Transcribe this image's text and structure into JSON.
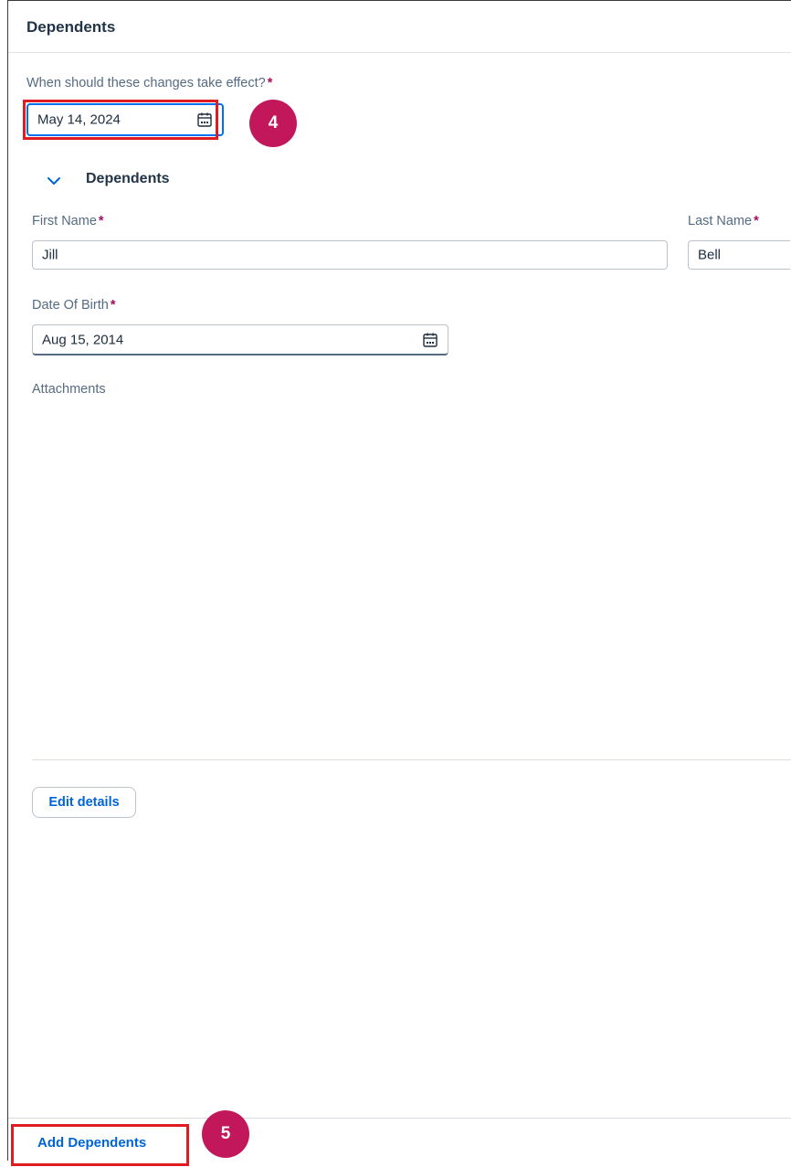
{
  "header": {
    "title": "Dependents"
  },
  "effective_date": {
    "label": "When should these changes take effect?",
    "required_mark": "*",
    "value": "May 14, 2024",
    "icon": "calendar-icon"
  },
  "callouts": {
    "step4": "4",
    "step5": "5"
  },
  "section": {
    "title": "Dependents",
    "toggle_icon": "chevron-down-icon"
  },
  "dependent": {
    "first_name_label": "First Name",
    "first_name_value": "Jill",
    "last_name_label": "Last Name",
    "last_name_value": "Bell",
    "dob_label": "Date Of Birth",
    "dob_value": "Aug 15, 2014",
    "attachments_label": "Attachments",
    "required_mark": "*"
  },
  "actions": {
    "edit_details_label": "Edit details",
    "add_dependents_label": "Add Dependents"
  },
  "colors": {
    "accent": "#0064d9",
    "required": "#aa0a5f",
    "callout_border": "#e11b22",
    "badge": "#c2185b"
  }
}
